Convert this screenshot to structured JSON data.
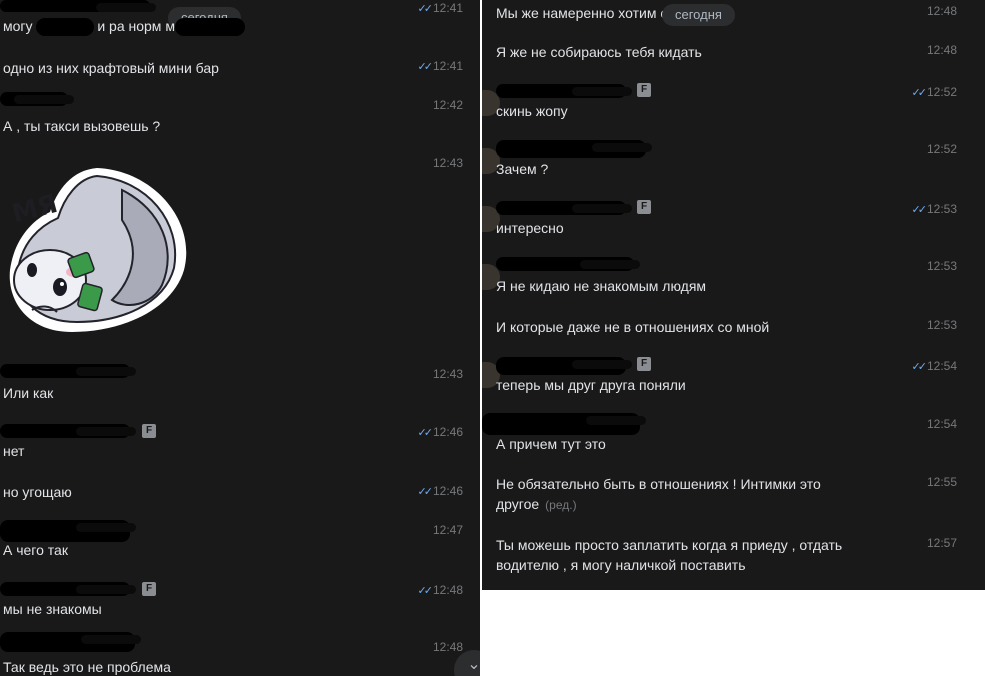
{
  "date_divider": "сегодня",
  "left": {
    "messages": [
      {
        "text": "могу показать и ра норм мест",
        "time": "12:41",
        "read": true
      },
      {
        "text": "одно из них крафтовый мини бар",
        "time": "12:41",
        "read": true
      },
      {
        "text": "А , ты такси вызовешь ?",
        "time": "12:42",
        "read": false
      },
      {
        "text": "",
        "time": "12:43",
        "read": false
      },
      {
        "text": "Или как",
        "time": "12:43",
        "read": false
      },
      {
        "text": "нет",
        "time": "12:46",
        "read": true
      },
      {
        "text": "но угощаю",
        "time": "12:46",
        "read": true
      },
      {
        "text": "А чего так",
        "time": "12:47",
        "read": false
      },
      {
        "text": "мы не знакомы",
        "time": "12:48",
        "read": true
      },
      {
        "text": "Так ведь это не проблема",
        "time": "12:48",
        "read": false
      }
    ],
    "sticker_caption": "МЯ",
    "badge": "F"
  },
  "right": {
    "messages": [
      {
        "text": "Мы же намеренно хотим ся",
        "time": "12:48",
        "read": false
      },
      {
        "text": "Я же не собираюсь тебя кидать",
        "time": "12:48",
        "read": false
      },
      {
        "text": "скинь жопу",
        "time": "12:52",
        "read": true
      },
      {
        "text": "Зачем ?",
        "time": "12:52",
        "read": false
      },
      {
        "text": "интересно",
        "time": "12:53",
        "read": true
      },
      {
        "text": "Я не кидаю не знакомым людям",
        "time": "12:53",
        "read": false
      },
      {
        "text": "И которые даже не в отношениях со мной",
        "time": "12:53",
        "read": false
      },
      {
        "text": "теперь мы друг друга поняли",
        "time": "12:54",
        "read": true
      },
      {
        "text": "А причем тут это",
        "time": "12:54",
        "read": false
      },
      {
        "text": "Не обязательно быть в отношениях ! Интимки это другое",
        "time": "12:55",
        "read": false,
        "edited": "(ред.)"
      },
      {
        "text": "Ты можешь просто заплатить когда я приеду , отдать водителю , я могу наличкой поставить",
        "time": "12:57",
        "read": false
      }
    ],
    "badge": "F"
  },
  "ticks_glyph": "✓✓",
  "scroll_glyph": "⌄",
  "colors": {
    "background": "#19191a",
    "text": "#e1e3e6",
    "time": "#76787a",
    "read_ticks": "#71aaeb",
    "pill": "#2c2d2e"
  }
}
